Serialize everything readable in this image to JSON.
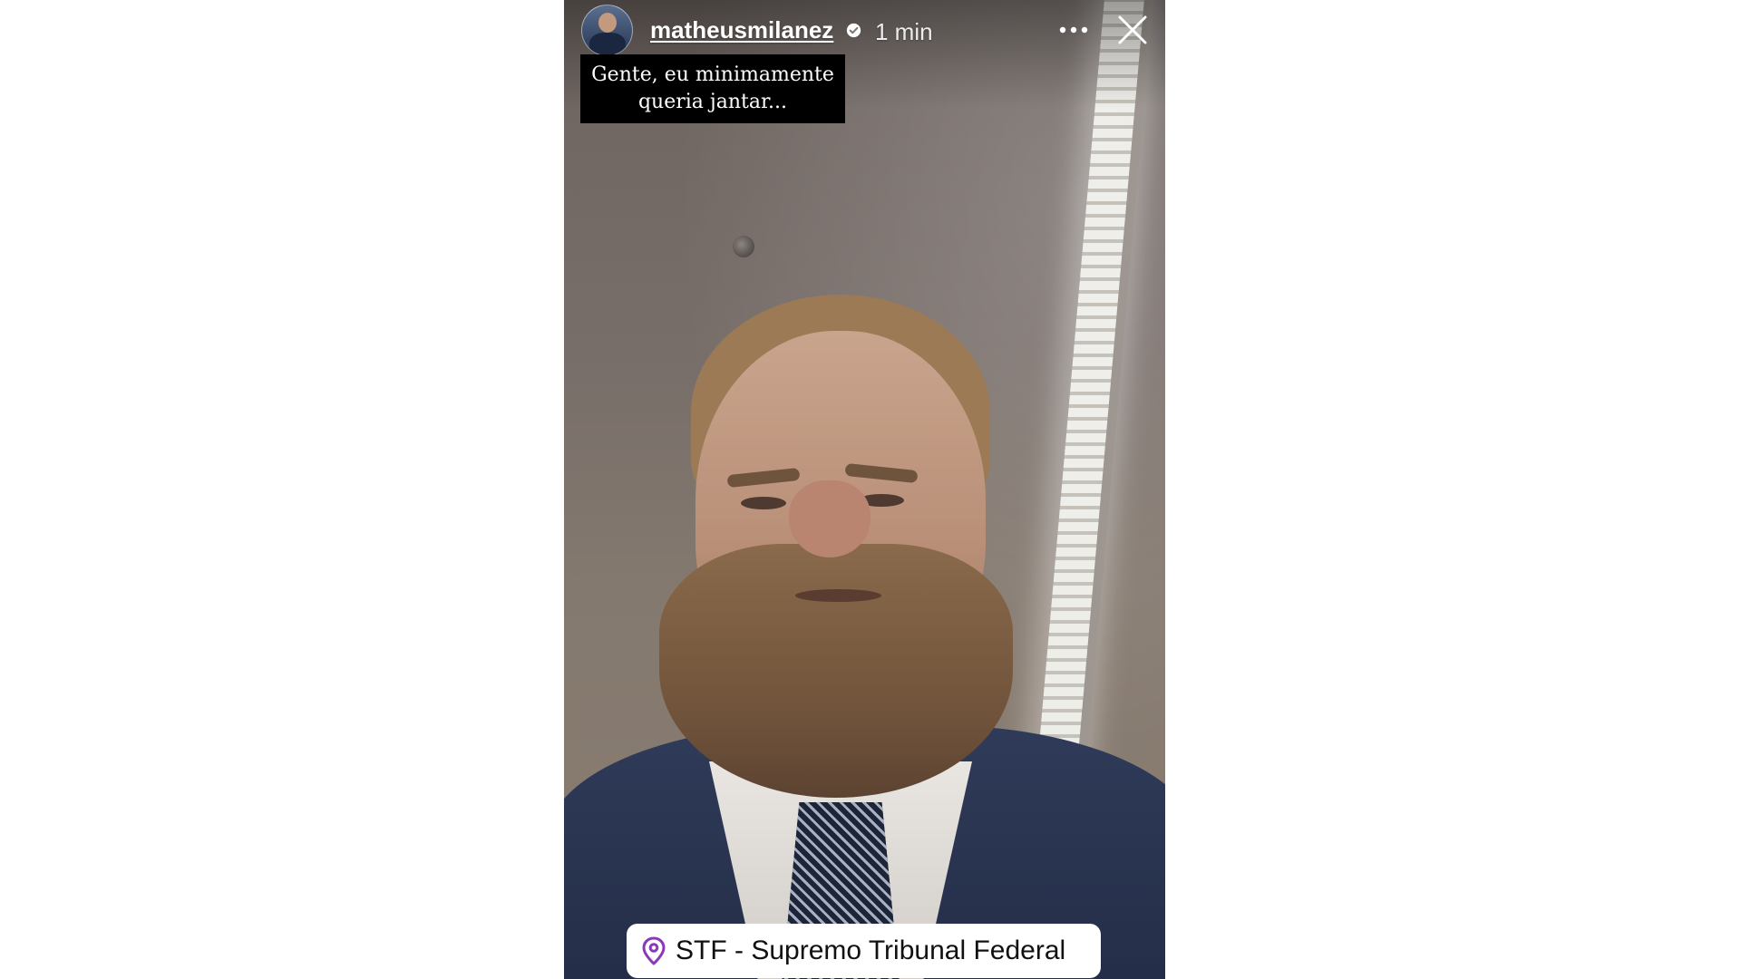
{
  "story": {
    "username": "matheusmilanez",
    "time": "1 min",
    "caption": "Gente, eu minimamente queria jantar...",
    "location": "STF - Supremo Tribunal Federal"
  },
  "icons": {
    "verified": "verified-badge-icon",
    "more": "more-options-icon",
    "close": "close-icon",
    "location": "location-pin-icon"
  },
  "colors": {
    "location_pin": "#8a3ab9",
    "caption_background": "#000000",
    "page_background": "#ffffff"
  }
}
